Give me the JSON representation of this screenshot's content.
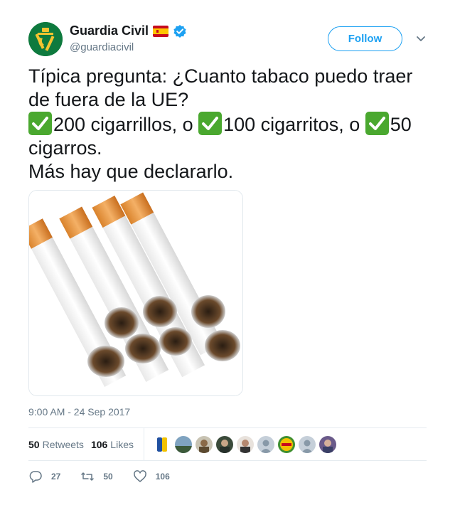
{
  "author": {
    "display_name": "Guardia Civil",
    "handle": "@guardiacivil",
    "verified": true,
    "flag": "spain-flag",
    "avatar_icon": "guardia-civil-emblem-icon"
  },
  "follow_label": "Follow",
  "tweet": {
    "line1": "Típica pregunta: ¿Cuanto tabaco puedo traer de fuera de la UE?",
    "option1": "200 cigarrillos, o ",
    "option2": "100 cigarritos, o ",
    "option3": "50 cigarros.",
    "line3": "Más hay que declararlo.",
    "check_icon": "white-check-mark-icon"
  },
  "media": {
    "subject": "cigarettes-photo"
  },
  "timestamp": "9:00 AM - 24 Sep 2017",
  "stats": {
    "retweets_count": "50",
    "retweets_label": "Retweets",
    "likes_count": "106",
    "likes_label": "Likes"
  },
  "actions": {
    "reply_count": "27",
    "retweet_count": "50",
    "like_count": "106"
  },
  "colors": {
    "accent": "#1da1f2",
    "secondary_text": "#657786",
    "check_green": "#4aa82f",
    "avatar_green": "#0e7a3e"
  }
}
